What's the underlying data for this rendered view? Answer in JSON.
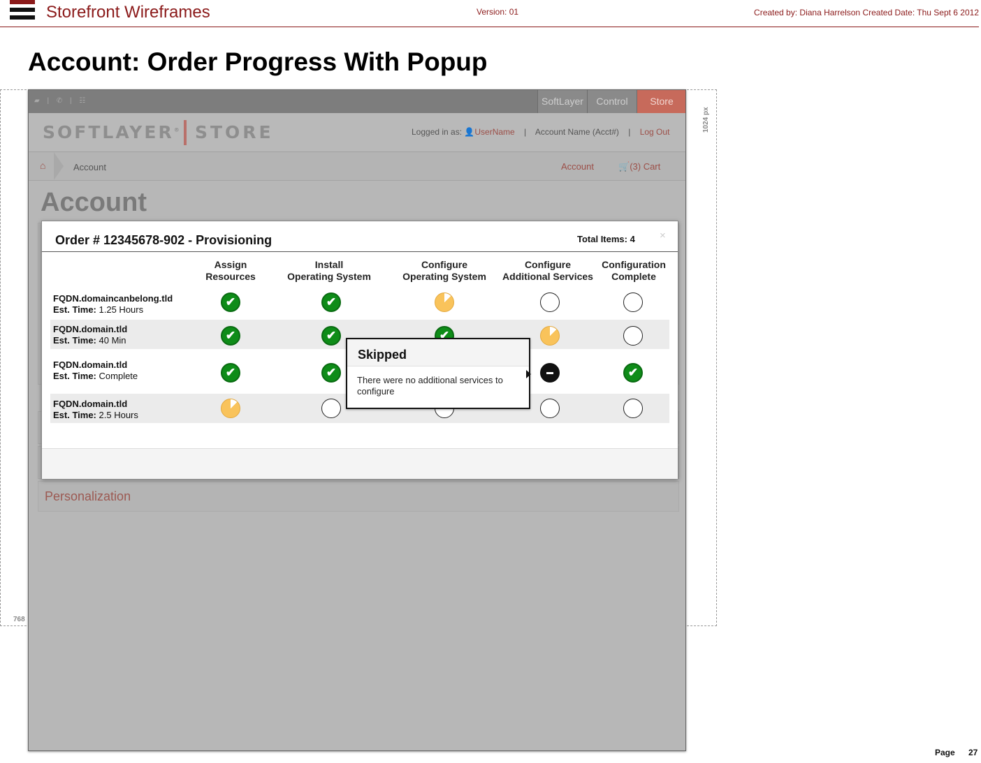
{
  "document": {
    "title": "Storefront Wireframes",
    "version": "Version: 01",
    "created": "Created by: Diana Harrelson  Created Date: Thu Sept 6 2012",
    "page_heading": "Account: Order Progress With Popup",
    "page_label": "Page",
    "page_number": "27",
    "width_guide": "1024 px",
    "height_guide": "768"
  },
  "app": {
    "top_tabs": [
      "SoftLayer",
      "Control",
      "Store"
    ],
    "active_tab": "Store",
    "logo_left": "SOFTLAYER",
    "logo_mark": "®",
    "logo_right": "STORE",
    "logged_in_label": "Logged in as:",
    "username": "UserName",
    "account_name": "Account Name (Acct#)",
    "logout": "Log Out",
    "breadcrumb": "Account",
    "nav_account": "Account",
    "cart": "(3) Cart",
    "page_title": "Account",
    "personalization": "Personalization"
  },
  "modal": {
    "title": "Order # 12345678-902 - Provisioning",
    "total_items": "Total Items: 4",
    "close": "×",
    "columns": [
      {
        "line1": "Assign",
        "line2": "Resources"
      },
      {
        "line1": "Install",
        "line2": "Operating System"
      },
      {
        "line1": "Configure",
        "line2": "Operating System"
      },
      {
        "line1": "Configure",
        "line2": "Additional Services"
      },
      {
        "line1": "Configuration",
        "line2": "Complete"
      }
    ],
    "est_label": "Est. Time:",
    "rows": [
      {
        "fqdn": "FQDN.domaincanbelong.tld",
        "est": "1.25 Hours",
        "statuses": [
          "done",
          "done",
          "progress",
          "empty",
          "empty"
        ]
      },
      {
        "fqdn": "FQDN.domain.tld",
        "est": "40 Min",
        "statuses": [
          "done",
          "done",
          "done",
          "progress",
          "empty"
        ]
      },
      {
        "fqdn": "FQDN.domain.tld",
        "est": "Complete",
        "statuses": [
          "done",
          "done",
          "done",
          "skipped",
          "done"
        ]
      },
      {
        "fqdn": "FQDN.domain.tld",
        "est": "2.5 Hours",
        "statuses": [
          "progress",
          "empty",
          "empty",
          "empty",
          "empty"
        ]
      }
    ]
  },
  "popup": {
    "title": "Skipped",
    "body": "There were no additional services to configure"
  }
}
